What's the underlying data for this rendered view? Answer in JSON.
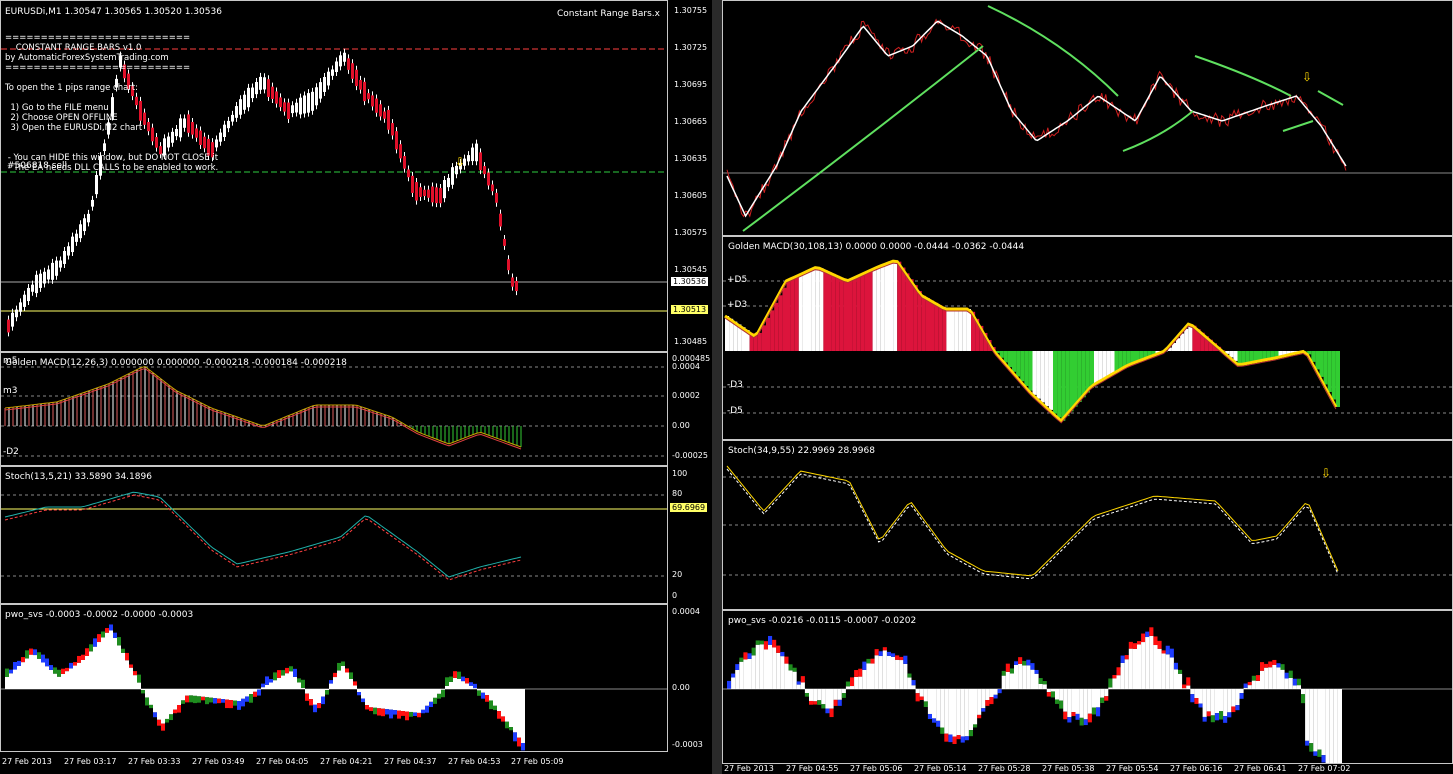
{
  "left": {
    "main": {
      "title": "EURUSDi,M1  1.30547 1.30565 1.30520 1.30536",
      "indicator_name": "Constant Range Bars.x",
      "price_axis": [
        "1.30755",
        "1.30725",
        "1.30695",
        "1.30665",
        "1.30635",
        "1.30605",
        "1.30575",
        "1.30545",
        "1.30485"
      ],
      "current_price": "1.30536",
      "yellow_price": "1.30513",
      "signal": "#506818 sell",
      "info_lines": [
        "==========================",
        "    CONSTANT RANGE BARS v1.0",
        "by AutomaticForexSystemTrading.com",
        "==========================",
        "",
        "To open the 1 pips range chart:",
        "",
        "  1) Go to the FILE menu",
        "  2) Choose OPEN OFFLINE",
        "  3) Open the EURUSDi,M2 chart",
        "",
        "",
        " - You can HIDE this window, but DO NOT CLOSE it",
        " - The EA needs DLL CALLS to be enabled to work."
      ]
    },
    "macd": {
      "title": "Golden MACD(12,26,3) 0.000000 0.000000 -0.000218 -0.000184 -0.000218",
      "level_labels": [
        "m5",
        "m3",
        "-D2"
      ],
      "axis": [
        "0.000485",
        "0.0004",
        "0.0002",
        "0.00",
        "-0.00025"
      ]
    },
    "stoch": {
      "title": "Stoch(13,5,21) 33.5890 34.1896",
      "axis": [
        "100",
        "80",
        "20",
        "0"
      ],
      "yellow_value": "69.6969"
    },
    "pwo": {
      "title": "pwo_svs -0.0003 -0.0002 -0.0000 -0.0003",
      "axis": [
        "0.0004",
        "0.00",
        "-0.0003"
      ]
    },
    "time_axis": [
      "27 Feb 2013",
      "27 Feb 03:17",
      "27 Feb 03:33",
      "27 Feb 03:49",
      "27 Feb 04:05",
      "27 Feb 04:21",
      "27 Feb 04:37",
      "27 Feb 04:53",
      "27 Feb 05:09"
    ]
  },
  "right": {
    "macd": {
      "title": "Golden MACD(30,108,13) 0.0000 0.0000 -0.0444 -0.0362 -0.0444",
      "level_labels": [
        "+D5",
        "+D3",
        "-D3",
        "-D5"
      ]
    },
    "stoch": {
      "title": "Stoch(34,9,55) 22.9969 28.9968"
    },
    "pwo": {
      "title": "pwo_svs -0.0216 -0.0115 -0.0007 -0.0202"
    },
    "time_axis": [
      "27 Feb 2013",
      "27 Feb 04:55",
      "27 Feb 05:06",
      "27 Feb 05:14",
      "27 Feb 05:28",
      "27 Feb 05:38",
      "27 Feb 05:54",
      "27 Feb 06:16",
      "27 Feb 06:41",
      "27 Feb 07:02"
    ]
  },
  "colors": {
    "bull_candle": "#ffffff",
    "bear_candle": "#e0102a",
    "macd_pos": "#dc143c",
    "macd_neg": "#32cd32",
    "signal_line": "#ffd700",
    "ma_line": "#5fe05f",
    "price_line": "#ffffff",
    "pwo_blue": "#1e3cff",
    "pwo_green": "#1e8c1e",
    "pwo_red": "#ff1010",
    "stoch_main": "#20b2aa",
    "stoch_signal": "#ff4040",
    "yellow_level": "#ffff66"
  }
}
